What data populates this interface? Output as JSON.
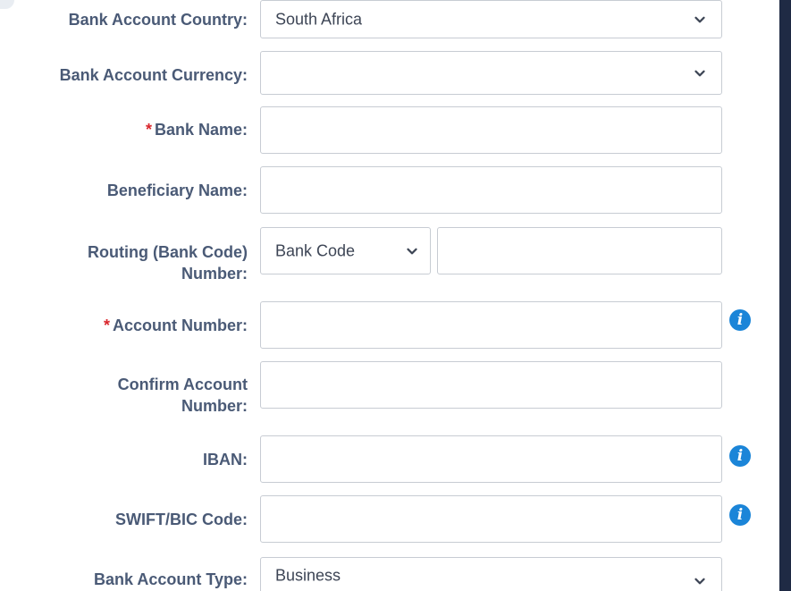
{
  "form": {
    "bank_account_country": {
      "label": "Bank Account Country:",
      "value": "South Africa",
      "chevron_icon": "chevron-down-icon"
    },
    "bank_account_currency": {
      "label": "Bank Account Currency:",
      "value": "",
      "chevron_icon": "chevron-down-icon"
    },
    "bank_name": {
      "required_marker": "*",
      "label": "Bank Name:",
      "value": ""
    },
    "beneficiary_name": {
      "label": "Beneficiary Name:",
      "value": ""
    },
    "routing_number": {
      "label_line1": "Routing (Bank Code)",
      "label_line2": "Number:",
      "code_type_value": "Bank Code",
      "value": ""
    },
    "account_number": {
      "required_marker": "*",
      "label": "Account Number:",
      "value": "",
      "info_icon": "info-icon",
      "info_glyph": "i"
    },
    "confirm_account_number": {
      "label_line1": "Confirm Account",
      "label_line2": "Number:",
      "value": ""
    },
    "iban": {
      "label": "IBAN:",
      "value": "",
      "info_glyph": "i"
    },
    "swift_bic": {
      "label": "SWIFT/BIC Code:",
      "value": "",
      "info_glyph": "i"
    },
    "bank_account_type": {
      "label": "Bank Account Type:",
      "value": "Business"
    }
  },
  "colors": {
    "label": "#4a5a76",
    "required": "#d9262c",
    "info_icon": "#1b85d8",
    "input_border": "#c7ccd3",
    "side_bar": "#1f2a44"
  }
}
